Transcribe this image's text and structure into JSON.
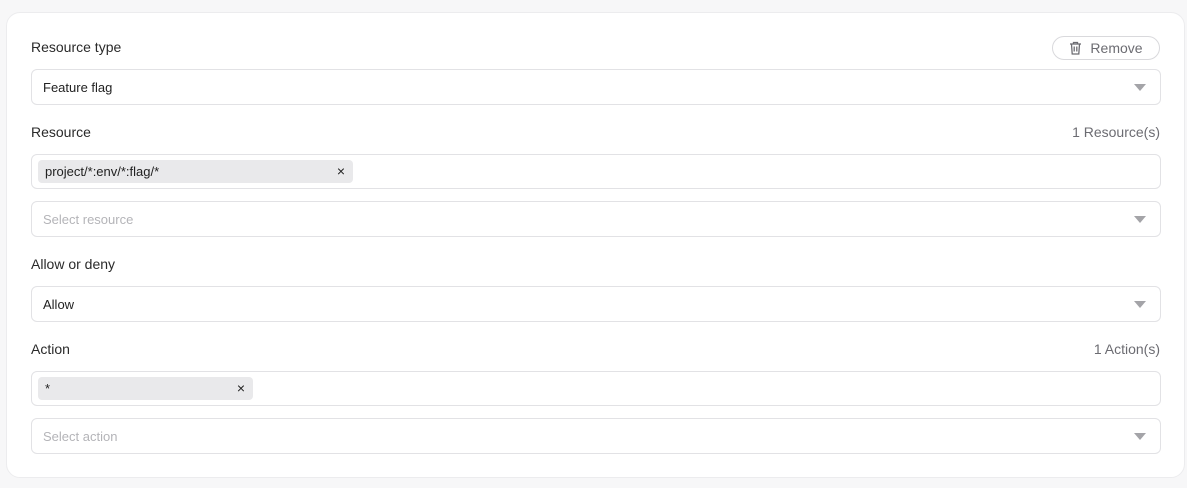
{
  "resource_type": {
    "label": "Resource type",
    "value": "Feature flag",
    "remove_label": "Remove"
  },
  "resource": {
    "label": "Resource",
    "count": "1 Resource(s)",
    "tags": [
      "project/*:env/*:flag/*"
    ],
    "placeholder": "Select resource"
  },
  "allow_deny": {
    "label": "Allow or deny",
    "value": "Allow"
  },
  "action": {
    "label": "Action",
    "count": "1 Action(s)",
    "tags": [
      "*"
    ],
    "placeholder": "Select action"
  },
  "icons": {
    "remove": "trash-icon",
    "dropdown": "caret-down-icon",
    "tag_remove": "close-icon"
  },
  "tag_close_glyph": "×"
}
